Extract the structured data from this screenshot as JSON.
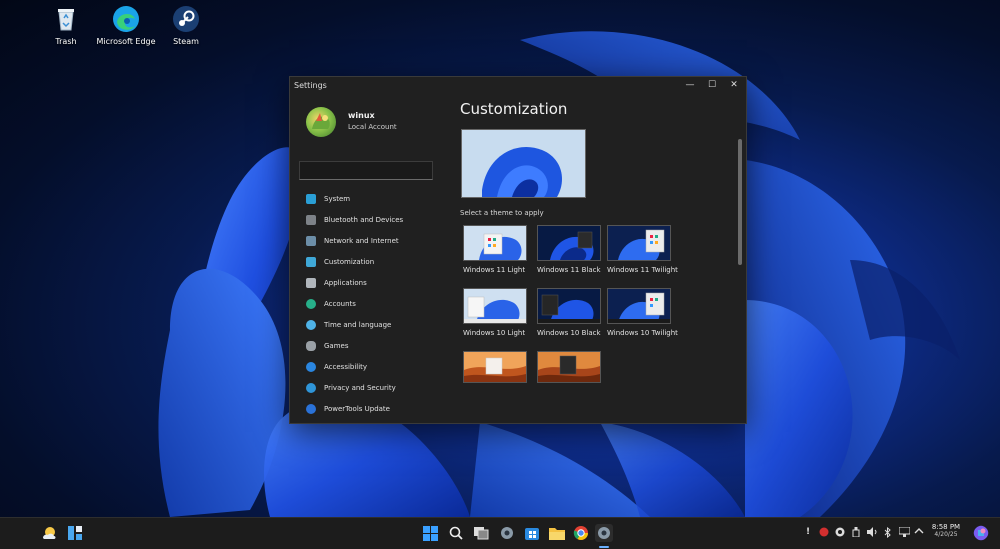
{
  "desktop": {
    "icons": [
      {
        "label": "Trash",
        "icon": "recycle-bin-icon"
      },
      {
        "label": "Microsoft Edge",
        "icon": "edge-icon"
      },
      {
        "label": "Steam",
        "icon": "steam-icon"
      }
    ]
  },
  "window": {
    "title": "Settings",
    "controls": {
      "minimize": "—",
      "maximize": "☐",
      "close": "✕"
    }
  },
  "profile": {
    "name": "winux",
    "account": "Local Account"
  },
  "search": {
    "value": "",
    "placeholder": ""
  },
  "nav": [
    {
      "label": "System",
      "icon": "monitor-icon",
      "color": "#2a9fd6"
    },
    {
      "label": "Bluetooth and Devices",
      "icon": "bluetooth-devices-icon",
      "color": "#9aa0a6"
    },
    {
      "label": "Network and Internet",
      "icon": "network-icon",
      "color": "#6c8ea8"
    },
    {
      "label": "Customization",
      "icon": "paintbrush-icon",
      "color": "#3fa8d8"
    },
    {
      "label": "Applications",
      "icon": "apps-icon",
      "color": "#b0b6bc"
    },
    {
      "label": "Accounts",
      "icon": "person-icon",
      "color": "#27b08a"
    },
    {
      "label": "Time and language",
      "icon": "globe-clock-icon",
      "color": "#4fb3e8"
    },
    {
      "label": "Games",
      "icon": "gamepad-icon",
      "color": "#9aa0a6"
    },
    {
      "label": "Accessibility",
      "icon": "accessibility-icon",
      "color": "#2a86e0"
    },
    {
      "label": "Privacy and Security",
      "icon": "shield-icon",
      "color": "#2f95d8"
    },
    {
      "label": "PowerTools Update",
      "icon": "update-icon",
      "color": "#2a72d8"
    }
  ],
  "content": {
    "title": "Customization",
    "subheading": "Select a theme to apply",
    "themes": [
      {
        "label": "Windows 11 Light",
        "style": "light11"
      },
      {
        "label": "Windows 11 Black",
        "style": "black11"
      },
      {
        "label": "Windows 11 Twilight",
        "style": "twilight11"
      },
      {
        "label": "Windows 10 Light",
        "style": "light10"
      },
      {
        "label": "Windows 10 Black",
        "style": "black10"
      },
      {
        "label": "Windows 10 Twilight",
        "style": "twilight10"
      },
      {
        "label": "",
        "style": "desert-light"
      },
      {
        "label": "",
        "style": "desert-dark"
      }
    ]
  },
  "taskbar": {
    "left": [
      "weather-icon",
      "widgets-icon"
    ],
    "center": [
      "start-icon",
      "search-icon",
      "task-view-icon",
      "settings-icon",
      "store-icon",
      "file-explorer-icon",
      "chrome-icon",
      "settings-app-icon"
    ],
    "tray": [
      "alert-icon",
      "antivirus-icon",
      "steam-tray-icon",
      "usb-icon",
      "volume-icon",
      "bluetooth-icon",
      "network-icon",
      "chevron-up-icon"
    ],
    "time": "8:58 PM",
    "date": "4/20/25"
  },
  "colors": {
    "accent": "#0067c0",
    "window_bg": "#202020",
    "taskbar_bg": "#1c1c1c"
  }
}
